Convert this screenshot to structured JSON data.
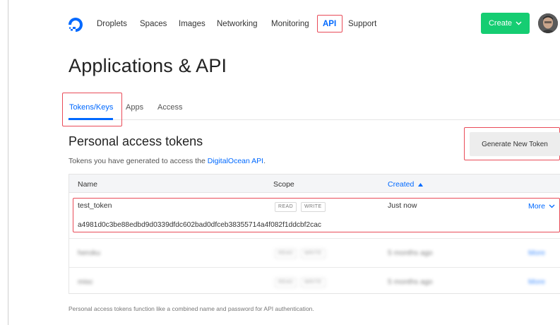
{
  "nav": {
    "items": [
      "Droplets",
      "Spaces",
      "Images",
      "Networking",
      "Monitoring",
      "API",
      "Support"
    ],
    "active": "API",
    "create_label": "Create"
  },
  "page": {
    "title": "Applications & API"
  },
  "tabs": [
    {
      "label": "Tokens/Keys",
      "active": true
    },
    {
      "label": "Apps",
      "active": false
    },
    {
      "label": "Access",
      "active": false
    }
  ],
  "tokens": {
    "heading": "Personal access tokens",
    "description_prefix": "Tokens you have generated to access the ",
    "description_link": "DigitalOcean API",
    "description_suffix": ".",
    "generate_label": "Generate New Token",
    "columns": {
      "name": "Name",
      "scope": "Scope",
      "created": "Created"
    },
    "rows": [
      {
        "name": "test_token",
        "scopes": [
          "READ",
          "WRITE"
        ],
        "created": "Just now",
        "more": "More",
        "token": "a4981d0c3be88edbd9d0339dfdc602bad0dfceb38355714a4f082f1ddcbf2cac"
      },
      {
        "name": "heroku",
        "scopes": [
          "READ",
          "WRITE"
        ],
        "created": "5 months ago",
        "more": "More"
      },
      {
        "name": "misc",
        "scopes": [
          "READ",
          "WRITE"
        ],
        "created": "5 months ago",
        "more": "More"
      }
    ],
    "footnote": "Personal access tokens function like a combined name and password for API authentication."
  },
  "colors": {
    "accent": "#0069ff",
    "create": "#15cd72",
    "highlight": "#e94b58"
  }
}
